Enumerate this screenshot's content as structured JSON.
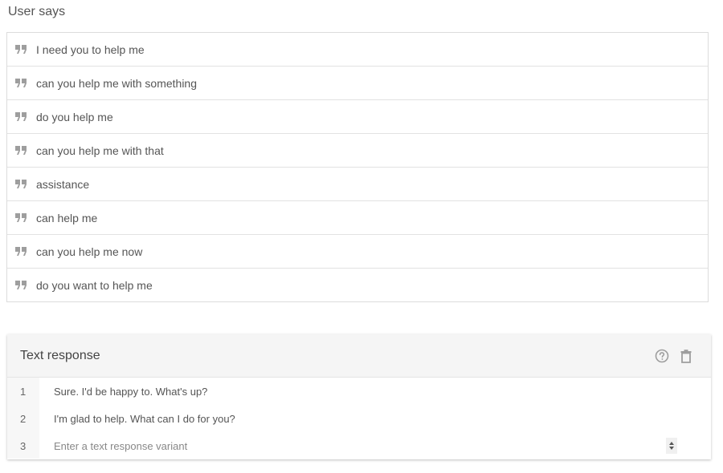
{
  "user_says": {
    "title": "User says",
    "phrases": [
      "I need you to help me",
      "can you help me with something",
      "do you help me",
      "can you help me with that",
      "assistance",
      "can help me",
      "can you help me now",
      "do you want to help me"
    ]
  },
  "text_response": {
    "title": "Text response",
    "icons": [
      "help-icon",
      "trash-icon"
    ],
    "variants": [
      {
        "number": "1",
        "text": "Sure. I'd be happy to. What's up?"
      },
      {
        "number": "2",
        "text": "I'm glad to help. What can I do for you?"
      }
    ],
    "new_variant": {
      "number": "3",
      "placeholder": "Enter a text response variant"
    }
  },
  "colors": {
    "quote_icon": "#9e9e9e",
    "header_icon": "#9e9e9e",
    "border": "#dcdcdc",
    "header_bg": "#f5f5f5"
  }
}
